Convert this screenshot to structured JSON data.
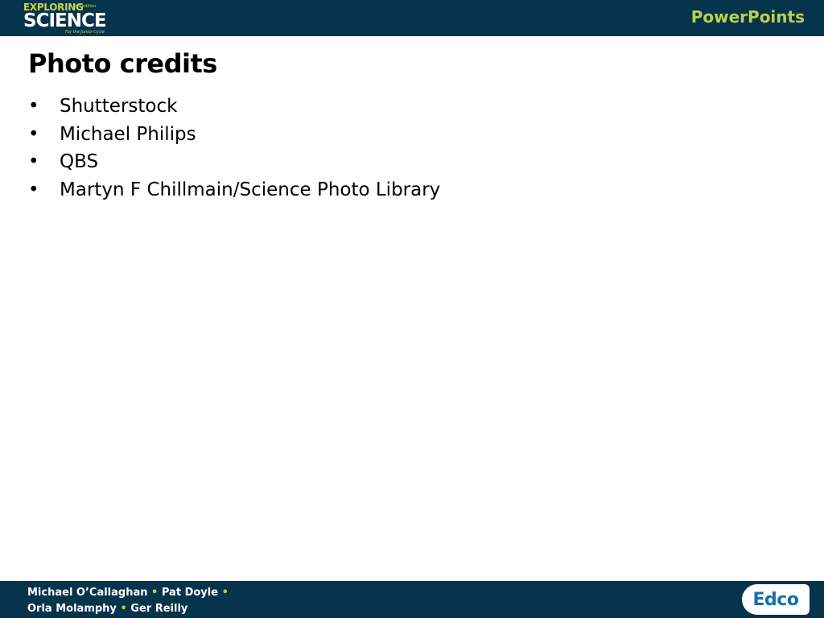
{
  "header": {
    "logo_line1": "EXPLORING",
    "logo_edition": "2nd edition",
    "logo_line2": "SCIENCE",
    "logo_line3": "For the Junior Cycle",
    "brand_right": "PowerPoints"
  },
  "slide": {
    "title": "Photo credits",
    "items": [
      "Shutterstock",
      "Michael Philips",
      "QBS",
      "Martyn F Chillmain/Science Photo Library"
    ]
  },
  "footer": {
    "author1": "Michael O’Callaghan",
    "author2": "Pat Doyle",
    "author3": "Orla Molamphy",
    "author4": "Ger Reilly",
    "publisher": "Edco"
  },
  "colors": {
    "bar": "#07344d",
    "accent": "#b9d14a",
    "publisher_blue": "#1a6fa8"
  }
}
